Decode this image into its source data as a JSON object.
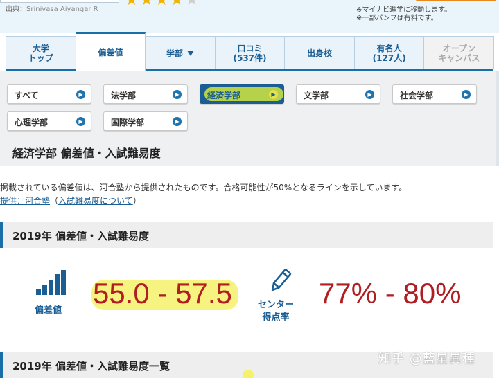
{
  "header": {
    "credit_prefix": "出典：",
    "credit_name": "Srinivasa Aiyangar R",
    "stars_filled": 4,
    "stars_total": 5,
    "note1": "※マイナビ進学に移動します。",
    "note2": "※一部パンフは有料です。"
  },
  "tabs": [
    {
      "line1": "大学",
      "line2": "トップ"
    },
    {
      "line1": "偏差値",
      "line2": ""
    },
    {
      "line1": "学部",
      "line2": ""
    },
    {
      "line1": "口コミ",
      "line2": "(537件)"
    },
    {
      "line1": "出身校",
      "line2": ""
    },
    {
      "line1": "有名人",
      "line2": "(127人)"
    },
    {
      "line1": "オープン",
      "line2": "キャンパス"
    }
  ],
  "faculties": [
    {
      "label": "すべて"
    },
    {
      "label": "法学部"
    },
    {
      "label": "経済学部"
    },
    {
      "label": "文学部"
    },
    {
      "label": "社会学部"
    },
    {
      "label": "心理学部"
    },
    {
      "label": "国際学部"
    }
  ],
  "section_title": "経済学部 偏差値・入試難易度",
  "description": "掲載されている偏差値は、河合塾から提供されたものです。合格可能性が50%となるラインを示しています。",
  "links": {
    "provider": "提供：河合塾",
    "about_open": "（",
    "about": "入試難易度について",
    "about_close": "）"
  },
  "year_header": "2019年 偏差値・入試難易度",
  "stats": {
    "hensachi_label": "偏差値",
    "hensachi_range": "55.0 - 57.5",
    "center_label_1": "センター",
    "center_label_2": "得点率",
    "center_range": "77% - 80%"
  },
  "year_header_list": "2019年 偏差値・入試難易度一覧",
  "watermark": "知乎 @藍星異種",
  "colors": {
    "accent": "#1a6ea8",
    "number_red": "#b01e22",
    "highlight_yellow": "#f6f16a",
    "star": "#f0b400"
  }
}
